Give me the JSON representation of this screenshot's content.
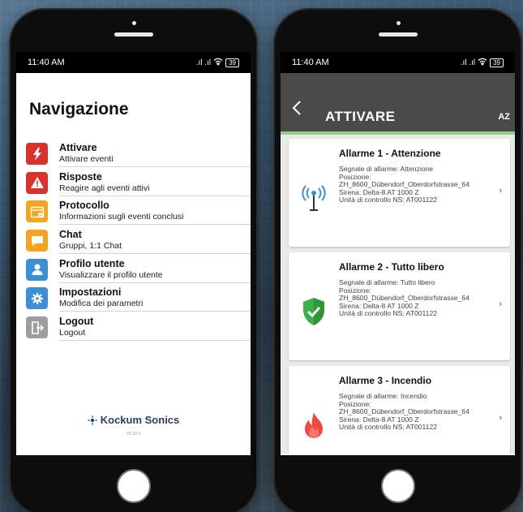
{
  "status_bar": {
    "time": "11:40 AM",
    "signal": ".ıl .ıl",
    "wifi": "wifi-icon",
    "battery": "39"
  },
  "left": {
    "title": "Navigazione",
    "items": [
      {
        "label": "Attivare",
        "sub": "Attivare eventi",
        "color": "#d9322c",
        "icon": "bolt-icon",
        "glyph": "⚡"
      },
      {
        "label": "Risposte",
        "sub": "Reagire agli eventi attivi",
        "color": "#d9322c",
        "icon": "warning-icon",
        "glyph": "!"
      },
      {
        "label": "Protocollo",
        "sub": "Informazioni sugli eventi conclusi",
        "color": "#f4a51f",
        "icon": "calendar-check-icon",
        "glyph": "✓"
      },
      {
        "label": "Chat",
        "sub": "Gruppi, 1:1 Chat",
        "color": "#f4a51f",
        "icon": "chat-icon",
        "glyph": "▬"
      },
      {
        "label": "Profilo utente",
        "sub": "Visualizzare il profilo utente",
        "color": "#3a8fd6",
        "icon": "user-icon",
        "glyph": "●"
      },
      {
        "label": "Impostazioni",
        "sub": "Modifica dei parametri",
        "color": "#3a8fd6",
        "icon": "gear-icon",
        "glyph": "✱"
      },
      {
        "label": "Logout",
        "sub": "Logout",
        "color": "#9e9e9e",
        "icon": "logout-icon",
        "glyph": "⇥"
      }
    ],
    "brand": "Kockum Sonics",
    "version": "V2.32.0"
  },
  "right": {
    "title": "ATTIVARE",
    "sort_label": "AZ",
    "alarms": [
      {
        "title": "Allarme 1 - Attenzione",
        "signal": "Segnale di allarme: Attenzione",
        "position_label": "Posizione:",
        "position": "ZH_8600_Dübendorf_Oberdorfstrasse_64",
        "siren": "Sirena: Delta-8 AT 1000 Z",
        "unit": "Unità di controllo NS: AT001122",
        "icon": "antenna-icon"
      },
      {
        "title": "Allarme 2 - Tutto libero",
        "signal": "Segnale di allarme: Tutto libero",
        "position_label": "Posizione:",
        "position": "ZH_8600_Dübendorf_Oberdorfstrasse_64",
        "siren": "Sirena: Delta-8 AT 1000 Z",
        "unit": "Unità di controllo NS: AT001122",
        "icon": "shield-check-icon"
      },
      {
        "title": "Allarme 3 - Incendio",
        "signal": "Segnale di allarme: Incendio",
        "position_label": "Posizione:",
        "position": "ZH_8600_Dübendorf_Oberdorfstrasse_64",
        "siren": "Sirena: Delta-8 AT 1000 Z",
        "unit": "Unità di controllo NS: AT001122",
        "icon": "fire-icon"
      }
    ]
  }
}
